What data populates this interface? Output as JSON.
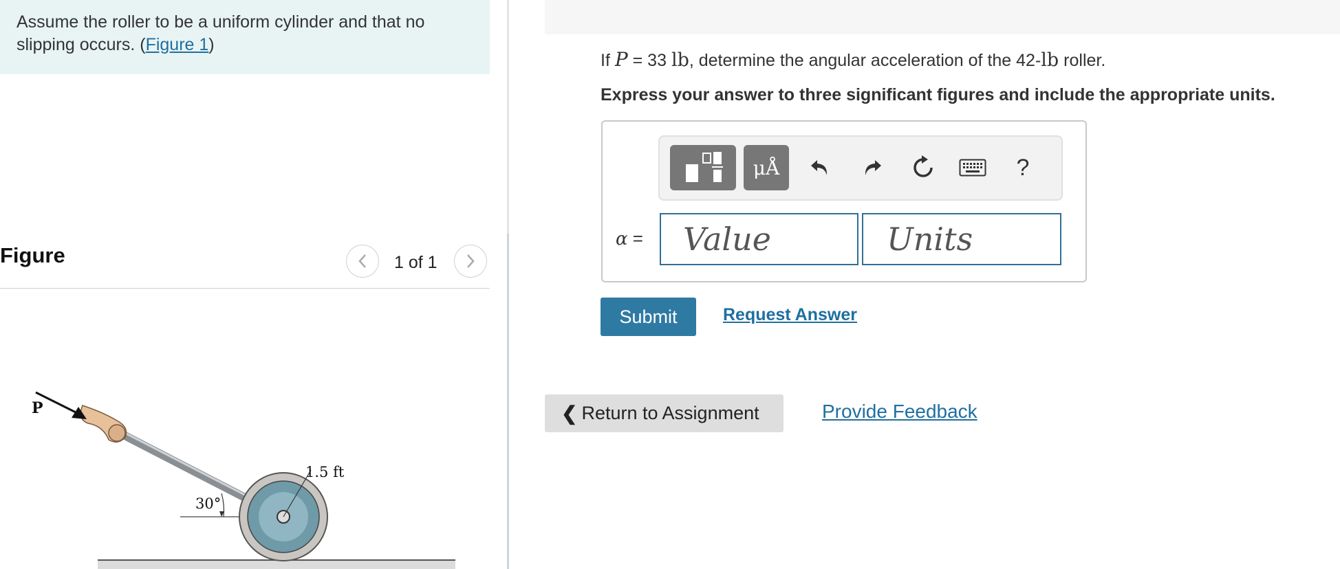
{
  "intro": {
    "text_before": "Assume the roller to be a uniform cylinder and that no slipping occurs. (",
    "figure_link": "Figure 1",
    "text_after": ")"
  },
  "figure_panel": {
    "title": "Figure",
    "pager_text": "1 of 1",
    "prev_icon": "chevron-left-icon",
    "next_icon": "chevron-right-icon",
    "diagram_labels": {
      "force": "P",
      "angle": "30°",
      "radius": "1.5 ft"
    }
  },
  "question": {
    "prefix": "If ",
    "symbol": "P",
    "equals": " = 33 ",
    "unit": "lb",
    "middle": ", determine the angular acceleration of the 42-",
    "unit2": "lb",
    "suffix": " roller.",
    "instruction": "Express your answer to three significant figures and include the appropriate units."
  },
  "answer": {
    "toolbar": {
      "templates_icon": "templates-icon",
      "symbols_label": "μÅ",
      "undo_icon": "undo-icon",
      "redo_icon": "redo-icon",
      "reset_icon": "reset-icon",
      "keyboard_icon": "keyboard-icon",
      "help_label": "?"
    },
    "variable": "α",
    "equals": " =",
    "value_placeholder": "Value",
    "units_placeholder": "Units"
  },
  "actions": {
    "submit_label": "Submit",
    "request_answer_label": "Request Answer",
    "return_label": "Return to Assignment",
    "feedback_label": "Provide Feedback"
  },
  "colors": {
    "accent": "#2f7aa3",
    "link": "#1f6fa0",
    "intro_bg": "#e8f4f4"
  }
}
